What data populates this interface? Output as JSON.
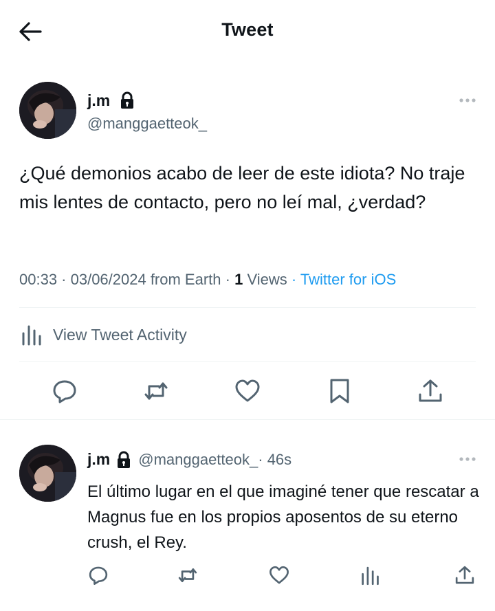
{
  "header": {
    "title": "Tweet"
  },
  "tweet": {
    "name": "j.m",
    "handle": "@manggaetteok_",
    "text": "¿Qué demonios acabo de leer de este idiota? No traje mis lentes de contacto, pero no leí mal, ¿verdad?",
    "time": "00:33 · 03/06/2024 from Earth · ",
    "views_count": "1",
    "views_label": " Views",
    "client": " · Twitter for iOS"
  },
  "activity": {
    "label": "View Tweet Activity"
  },
  "reply": {
    "name": "j.m",
    "handle": "@manggaetteok_",
    "time": " · 46s",
    "text": "El último lugar en el que imaginé tener que rescatar a Magnus fue en los propios aposentos de su eterno crush, el Rey."
  },
  "colors": {
    "accent": "#1d9bf0",
    "secondary_text": "#536471",
    "divider": "#eff3f4"
  },
  "icons": [
    "back-arrow-icon",
    "lock-icon",
    "more-icon",
    "bar-chart-icon",
    "reply-icon",
    "retweet-icon",
    "like-icon",
    "bookmark-icon",
    "share-icon"
  ]
}
